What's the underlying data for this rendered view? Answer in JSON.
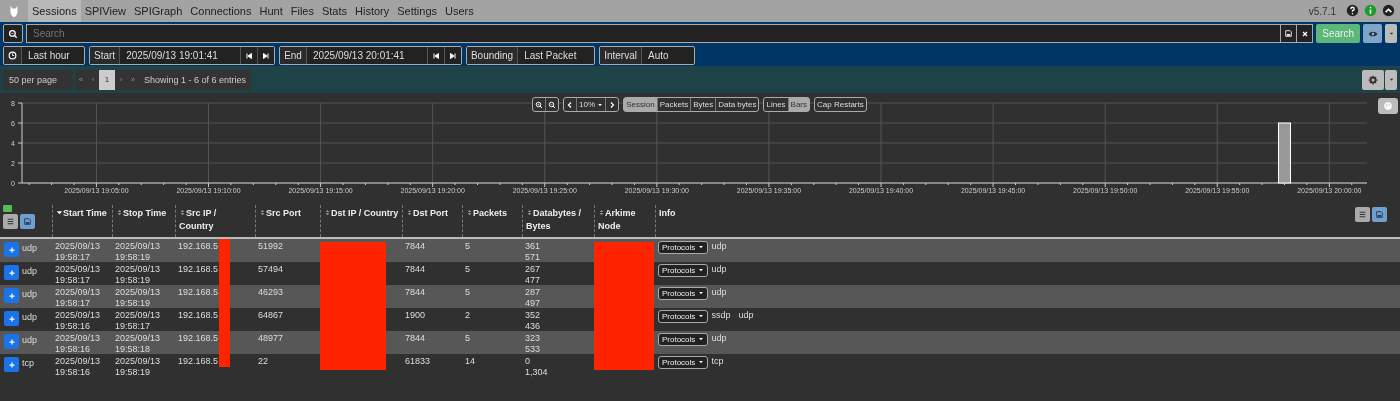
{
  "nav": {
    "items": [
      {
        "label": "Sessions",
        "selected": true
      },
      {
        "label": "SPIView",
        "selected": false
      },
      {
        "label": "SPIGraph",
        "selected": false
      },
      {
        "label": "Connections",
        "selected": false
      },
      {
        "label": "Hunt",
        "selected": false
      },
      {
        "label": "Files",
        "selected": false
      },
      {
        "label": "Stats",
        "selected": false
      },
      {
        "label": "History",
        "selected": false
      },
      {
        "label": "Settings",
        "selected": false
      },
      {
        "label": "Users",
        "selected": false
      }
    ],
    "version": "v5.7.1"
  },
  "search": {
    "placeholder": "Search",
    "button": "Search"
  },
  "time": {
    "range": "Last hour",
    "start_label": "Start",
    "start": "2025/09/13 19:01:41",
    "end_label": "End",
    "end": "2025/09/13 20:01:41",
    "bounding_label": "Bounding",
    "bounding": "Last Packet",
    "interval_label": "Interval",
    "interval": "Auto"
  },
  "paging": {
    "per_page": "50 per page",
    "pages": [
      {
        "label": "«",
        "selected": false
      },
      {
        "label": "‹",
        "selected": false
      },
      {
        "label": "1",
        "selected": true
      },
      {
        "label": "›",
        "selected": false
      },
      {
        "label": "»",
        "selected": false
      }
    ],
    "showing": "Showing 1 - 6 of 6 entries"
  },
  "graph": {
    "zoom": "10%",
    "metrics": [
      {
        "label": "Session",
        "selected": true
      },
      {
        "label": "Packets",
        "selected": false
      },
      {
        "label": "Bytes",
        "selected": false
      },
      {
        "label": "Data bytes",
        "selected": false
      }
    ],
    "styles": [
      {
        "label": "Lines",
        "selected": false
      },
      {
        "label": "Bars",
        "selected": true
      }
    ],
    "cap_restarts": "Cap Restarts",
    "chart_data": {
      "type": "bar",
      "grid": true,
      "ylim": [
        0,
        8
      ],
      "yticks": [
        0,
        2,
        4,
        6,
        8
      ],
      "categories": [
        null,
        null,
        null,
        "2025/09/13 19:05:00",
        null,
        null,
        null,
        null,
        "2025/09/13 19:10:00",
        null,
        null,
        null,
        null,
        "2025/09/13 19:15:00",
        null,
        null,
        null,
        null,
        "2025/09/13 19:20:00",
        null,
        null,
        null,
        null,
        "2025/09/13 19:25:00",
        null,
        null,
        null,
        null,
        "2025/09/13 19:30:00",
        null,
        null,
        null,
        null,
        "2025/09/13 19:35:00",
        null,
        null,
        null,
        null,
        "2025/09/13 19:40:00",
        null,
        null,
        null,
        null,
        "2025/09/13 19:45:00",
        null,
        null,
        null,
        null,
        "2025/09/13 19:50:00",
        null,
        null,
        null,
        null,
        "2025/09/13 19:55:00",
        null,
        null,
        null,
        null,
        "2025/09/13 20:00:00",
        null
      ],
      "values": [
        0,
        0,
        0,
        0,
        0,
        0,
        0,
        0,
        0,
        0,
        0,
        0,
        0,
        0,
        0,
        0,
        0,
        0,
        0,
        0,
        0,
        0,
        0,
        0,
        0,
        0,
        0,
        0,
        0,
        0,
        0,
        0,
        0,
        0,
        0,
        0,
        0,
        0,
        0,
        0,
        0,
        0,
        0,
        0,
        0,
        0,
        0,
        0,
        0,
        0,
        0,
        0,
        0,
        0,
        0,
        0,
        6,
        0,
        0,
        0
      ]
    }
  },
  "table": {
    "columns": [
      {
        "label": "Start Time",
        "sorted": true,
        "redacted": false
      },
      {
        "label": "Stop Time",
        "sorted": false,
        "redacted": false
      },
      {
        "label": "Src IP / Country",
        "sorted": false,
        "redacted": true
      },
      {
        "label": "Src Port",
        "sorted": false,
        "redacted": false
      },
      {
        "label": "Dst IP / Country",
        "sorted": false,
        "redacted": true
      },
      {
        "label": "Dst Port",
        "sorted": false,
        "redacted": false
      },
      {
        "label": "Packets",
        "sorted": false,
        "redacted": false
      },
      {
        "label": "Databytes / Bytes",
        "sorted": false,
        "redacted": false
      },
      {
        "label": "Arkime Node",
        "sorted": false,
        "redacted": true
      },
      {
        "label": "Info",
        "redacted": false
      }
    ],
    "rows": [
      {
        "protocol": "udp",
        "start": "2025/09/13 19:58:17",
        "stop": "2025/09/13 19:58:19",
        "src_ip": "192.168.5",
        "src_port": "51992",
        "dst_port": "7844",
        "packets": "5",
        "databytes": "361",
        "bytes": "571",
        "info_button": "Protocols",
        "protocols": [
          "udp"
        ]
      },
      {
        "protocol": "udp",
        "start": "2025/09/13 19:58:17",
        "stop": "2025/09/13 19:58:19",
        "src_ip": "192.168.5",
        "src_port": "57494",
        "dst_port": "7844",
        "packets": "5",
        "databytes": "267",
        "bytes": "477",
        "info_button": "Protocols",
        "protocols": [
          "udp"
        ]
      },
      {
        "protocol": "udp",
        "start": "2025/09/13 19:58:17",
        "stop": "2025/09/13 19:58:19",
        "src_ip": "192.168.5",
        "src_port": "46293",
        "dst_port": "7844",
        "packets": "5",
        "databytes": "287",
        "bytes": "497",
        "info_button": "Protocols",
        "protocols": [
          "udp"
        ]
      },
      {
        "protocol": "udp",
        "start": "2025/09/13 19:58:16",
        "stop": "2025/09/13 19:58:17",
        "src_ip": "192.168.5",
        "src_port": "64867",
        "dst_port": "1900",
        "packets": "2",
        "databytes": "352",
        "bytes": "436",
        "info_button": "Protocols",
        "protocols": [
          "ssdp",
          "udp"
        ]
      },
      {
        "protocol": "udp",
        "start": "2025/09/13 19:58:16",
        "stop": "2025/09/13 19:58:18",
        "src_ip": "192.168.5",
        "src_port": "48977",
        "dst_port": "7844",
        "packets": "5",
        "databytes": "323",
        "bytes": "533",
        "info_button": "Protocols",
        "protocols": [
          "udp"
        ]
      },
      {
        "protocol": "tcp",
        "start": "2025/09/13 19:58:16",
        "stop": "2025/09/13 19:58:19",
        "src_ip": "192.168.5",
        "src_port": "22",
        "dst_port": "61833",
        "packets": "14",
        "databytes": "0",
        "bytes": "1,304",
        "info_button": "Protocols",
        "protocols": [
          "tcp"
        ]
      }
    ]
  }
}
